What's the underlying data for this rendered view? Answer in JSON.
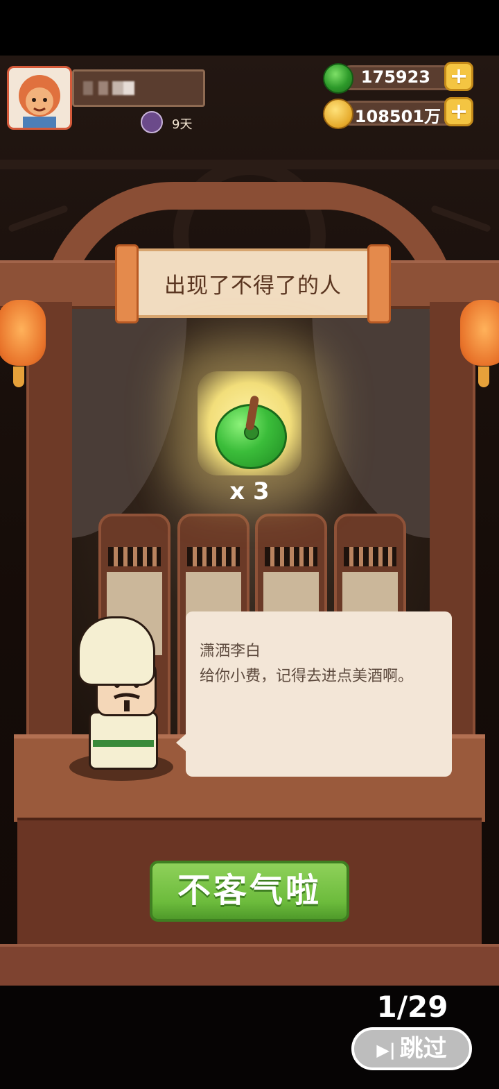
{
  "player": {
    "days_label": "9天"
  },
  "currencies": {
    "jade": "175923",
    "coins": "108501万",
    "plus_symbol": "+"
  },
  "event": {
    "title": "出现了不得了的人",
    "reward_count": "x 3"
  },
  "dialog": {
    "speaker": "潇洒李白",
    "line": "给你小费，记得去进点美酒啊。"
  },
  "actions": {
    "confirm_label": "不客气啦",
    "skip_label": "跳过",
    "skip_icon": "▶|"
  },
  "progress": {
    "label": "1/29"
  },
  "colors": {
    "confirm_button": "#6cbb3c",
    "plus_button": "#f4c542",
    "dialog_bg": "#f3e6d7"
  }
}
